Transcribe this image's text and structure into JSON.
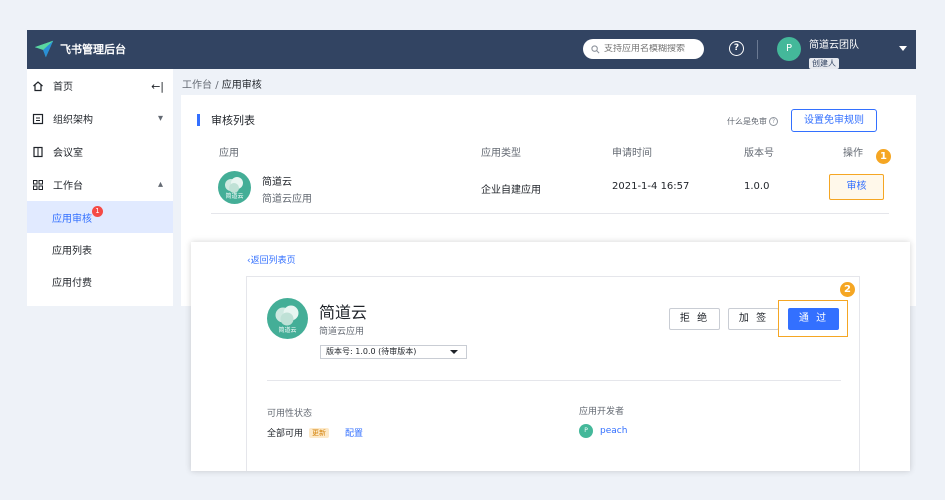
{
  "topbar": {
    "title": "飞书管理后台",
    "search_placeholder": "支持应用名模糊搜索",
    "help_icon": "?",
    "avatar_letter": "P",
    "team_name": "简道云团队",
    "role": "创建人"
  },
  "sidebar": {
    "home": "首页",
    "org": "组织架构",
    "meeting": "会议室",
    "workbench": "工作台",
    "sub_items": [
      "应用审核",
      "应用列表",
      "应用付费"
    ],
    "badge": "1",
    "collapse_icon": "←|"
  },
  "breadcrumb": {
    "root": "工作台",
    "separator": "/",
    "current": "应用审核"
  },
  "review_list": {
    "title": "审核列表",
    "free_review_text": "什么是免审",
    "rule_button": "设置免审规则",
    "columns": [
      "应用",
      "应用类型",
      "申请时间",
      "版本号",
      "操作"
    ],
    "row": {
      "app_logo_text": "简道云",
      "app_name": "简道云",
      "app_sub": "简道云应用",
      "type": "企业自建应用",
      "time": "2021-1-4 16:57",
      "version": "1.0.0",
      "action": "审核"
    }
  },
  "steps": [
    "1",
    "2"
  ],
  "detail": {
    "back": "返回列表页",
    "logo_text": "简道云",
    "app_name": "简道云",
    "app_sub": "简道云应用",
    "version_select": "版本号: 1.0.0 (待审版本)",
    "reject_button": "拒 绝",
    "add_sign_button": "加 签",
    "approve_button": "通 过",
    "availability_label": "可用性状态",
    "availability_value": "全部可用",
    "update_tag": "更新",
    "config_link": "配置",
    "developer_label": "应用开发者",
    "developer_avatar": "P",
    "developer_name": "peach"
  },
  "colors": {
    "topbar": "#324462",
    "primary": "#3370ff",
    "highlight": "#f5a623",
    "brand_green": "#44ae97"
  }
}
